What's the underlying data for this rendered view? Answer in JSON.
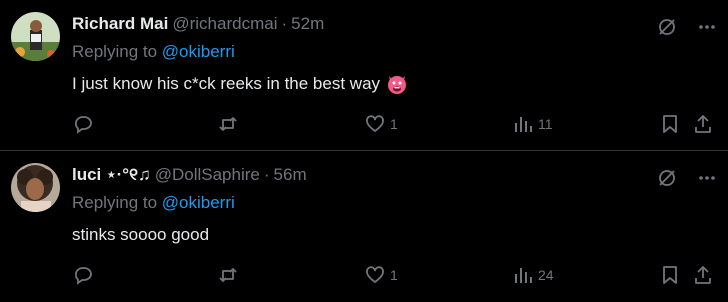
{
  "tweets": [
    {
      "display_name": "Richard Mai",
      "handle": "@richardcmai",
      "separator": "·",
      "time": "52m",
      "replying_prefix": "Replying to ",
      "replying_to": "@okiberri",
      "text": "I just know his c*ck reeks in the best way",
      "emoji": "smiling-face-with-horns-emoji",
      "reply_count": "",
      "retweet_count": "",
      "like_count": "1",
      "view_count": "11"
    },
    {
      "display_name": "luci ⋆·°୧♫",
      "handle": "@DollSaphire",
      "separator": "·",
      "time": "56m",
      "replying_prefix": "Replying to ",
      "replying_to": "@okiberri",
      "text": "stinks soooo good",
      "emoji": "",
      "reply_count": "",
      "retweet_count": "",
      "like_count": "1",
      "view_count": "24"
    }
  ],
  "colors": {
    "background": "#000000",
    "text": "#e7e9ea",
    "muted": "#71767b",
    "link": "#1d9bf0",
    "divider": "#2f3336"
  }
}
